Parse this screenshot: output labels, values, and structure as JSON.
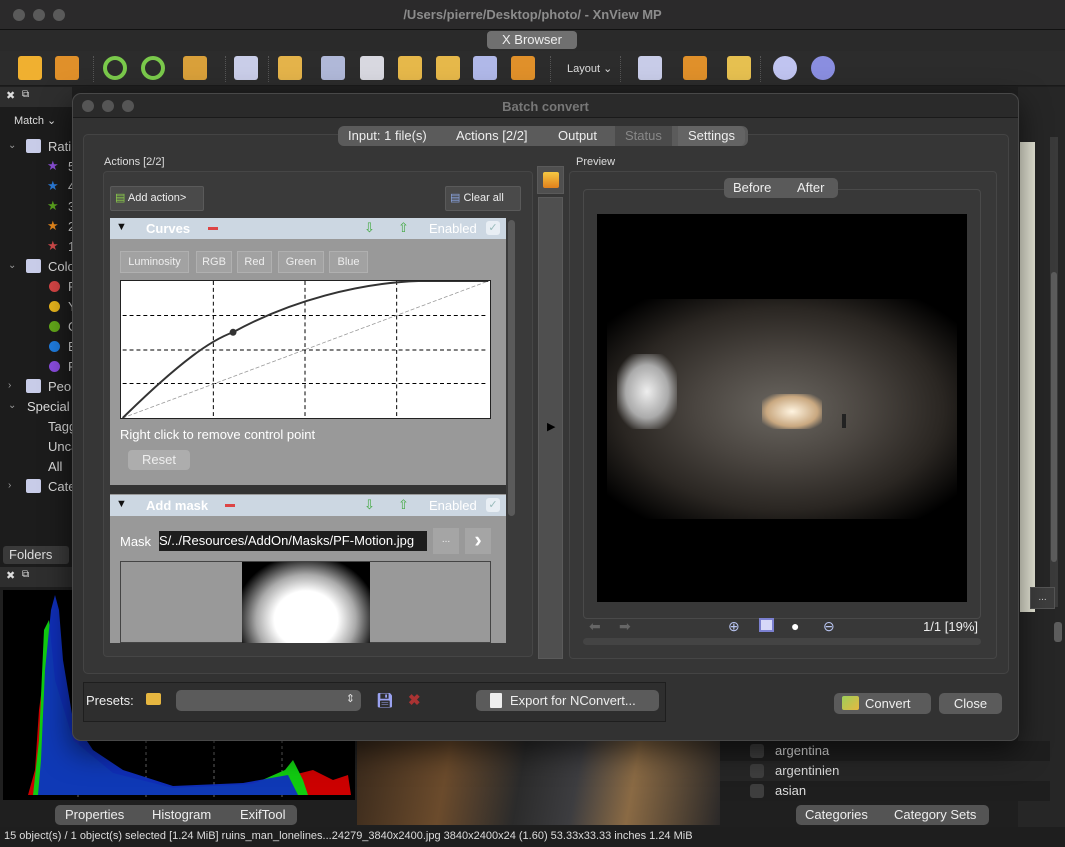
{
  "window": {
    "title": "/Users/pierre/Desktop/photo/ - XnView MP",
    "tab": "X Browser"
  },
  "toolbar": {
    "layout_label": "Layout",
    "icons": [
      "view-icon",
      "fullscreen-icon",
      "rotate-left-icon",
      "rotate-right-icon",
      "convert-icon",
      "info-icon",
      "move-to-icon",
      "find-icon",
      "print-icon",
      "export-icon",
      "batch-icon",
      "capture-icon",
      "slideshow-icon",
      "rating-icon",
      "category-icon",
      "folder-compare-icon",
      "settings-icon",
      "help-icon"
    ]
  },
  "left_panel": {
    "match_label": "Match",
    "tree": [
      {
        "label": "Ratings",
        "indent": 0,
        "icon": "rating-folder-icon",
        "expanded": true
      },
      {
        "label": "5",
        "indent": 1,
        "icon": "star-icon",
        "color": "#8a4fd6"
      },
      {
        "label": "4",
        "indent": 1,
        "icon": "star-icon",
        "color": "#2b7bd8"
      },
      {
        "label": "3",
        "indent": 1,
        "icon": "star-icon",
        "color": "#5aa31e"
      },
      {
        "label": "2",
        "indent": 1,
        "icon": "star-icon",
        "color": "#e5871c"
      },
      {
        "label": "1",
        "indent": 1,
        "icon": "star-icon",
        "color": "#d04a4a"
      },
      {
        "label": "Color Labels",
        "indent": 0,
        "icon": "color-folder-icon",
        "expanded": true
      },
      {
        "label": "Red",
        "indent": 1,
        "icon": "dot-icon",
        "color": "#d64545"
      },
      {
        "label": "Yellow",
        "indent": 1,
        "icon": "dot-icon",
        "color": "#e8b51c"
      },
      {
        "label": "Green",
        "indent": 1,
        "icon": "dot-icon",
        "color": "#63a81a"
      },
      {
        "label": "Blue",
        "indent": 1,
        "icon": "dot-icon",
        "color": "#1f7de0"
      },
      {
        "label": "Purple",
        "indent": 1,
        "icon": "dot-icon",
        "color": "#8b4ce0"
      },
      {
        "label": "People",
        "indent": 0,
        "icon": "people-folder-icon",
        "expanded": false
      },
      {
        "label": "Special",
        "indent": 0,
        "icon": "",
        "expanded": true
      },
      {
        "label": "Tagged",
        "indent": 1,
        "icon": ""
      },
      {
        "label": "Uncategorized",
        "indent": 1,
        "icon": ""
      },
      {
        "label": "All",
        "indent": 1,
        "icon": ""
      },
      {
        "label": "Categories",
        "indent": 0,
        "icon": "category-folder-icon",
        "expanded": false
      }
    ],
    "folders_tab": "Folders"
  },
  "histogram": {
    "tabs": [
      "Properties",
      "Histogram",
      "ExifTool"
    ]
  },
  "categories": {
    "items": [
      "argentina",
      "argentinien",
      "asian"
    ],
    "tabs": [
      "Categories",
      "Category Sets"
    ]
  },
  "status_bar": "15 object(s) / 1 object(s) selected [1.24 MiB]   ruins_man_lonelines...24279_3840x2400.jpg   3840x2400x24 (1.60)   53.33x33.33 inches   1.24 MiB",
  "dialog": {
    "title": "Batch convert",
    "tabs": [
      {
        "label": "Input: 1 file(s)",
        "enabled": true
      },
      {
        "label": "Actions [2/2]",
        "enabled": true
      },
      {
        "label": "Output",
        "enabled": true
      },
      {
        "label": "Status",
        "enabled": false
      },
      {
        "label": "Settings",
        "enabled": true
      }
    ],
    "actions_label": "Actions [2/2]",
    "add_action": "Add action>",
    "clear_all": "Clear all",
    "curves": {
      "title": "Curves",
      "enabled_label": "Enabled",
      "enabled": true,
      "channels": [
        "Luminosity",
        "RGB",
        "Red",
        "Green",
        "Blue"
      ],
      "hint": "Right click to remove control point",
      "reset": "Reset",
      "control_point": {
        "input": 0.3,
        "output": 0.68
      }
    },
    "mask": {
      "title": "Add mask",
      "enabled_label": "Enabled",
      "enabled": true,
      "mask_label": "Mask",
      "mask_path": "S/../Resources/AddOn/Masks/PF-Motion.jpg",
      "browse": "...",
      "next": "›"
    },
    "preview": {
      "label": "Preview",
      "before": "Before",
      "after": "After",
      "page_status": "1/1 [19%]"
    },
    "presets_label": "Presets:",
    "presets_value": "",
    "export_nconvert": "Export for NConvert...",
    "convert": "Convert",
    "close": "Close"
  }
}
